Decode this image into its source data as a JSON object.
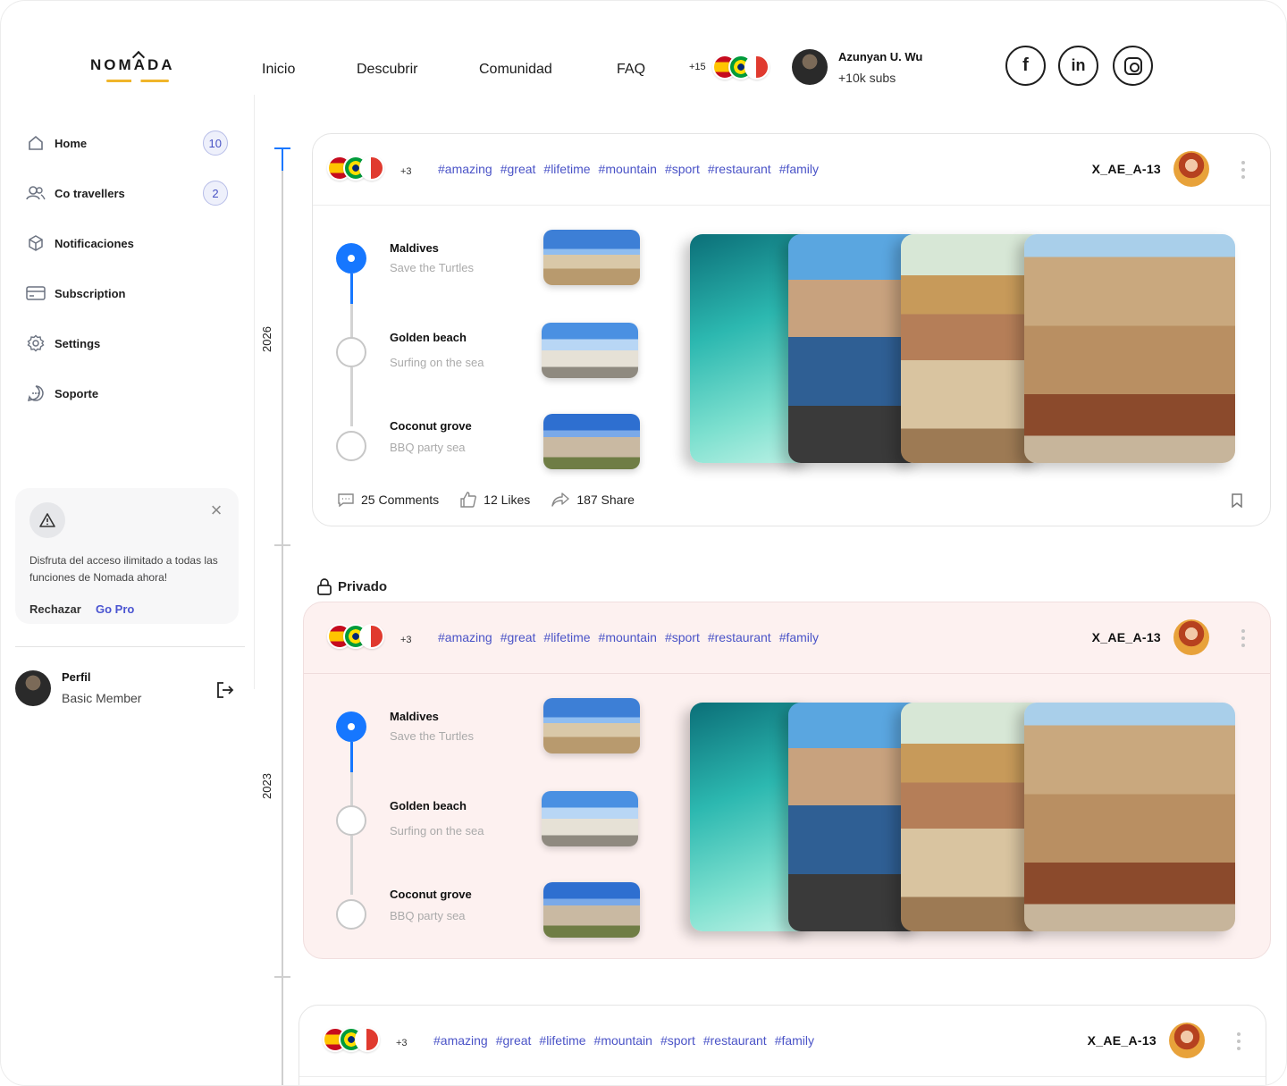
{
  "brand": {
    "logo_text": "NOMADA"
  },
  "nav": {
    "links": [
      "Inicio",
      "Descubrir",
      "Comunidad",
      "FAQ"
    ],
    "flag_extra": "+15",
    "user": {
      "name": "Azunyan U. Wu",
      "subs": "+10k subs"
    },
    "social": [
      "facebook-icon",
      "linkedin-icon",
      "instagram-icon"
    ]
  },
  "sidebar": {
    "items": [
      {
        "label": "Home",
        "icon": "home-icon",
        "badge": "10"
      },
      {
        "label": "Co travellers",
        "icon": "users-icon",
        "badge": "2"
      },
      {
        "label": "Notificaciones",
        "icon": "cube-icon",
        "badge": ""
      },
      {
        "label": "Subscription",
        "icon": "card-icon",
        "badge": ""
      },
      {
        "label": "Settings",
        "icon": "gear-icon",
        "badge": ""
      },
      {
        "label": "Soporte",
        "icon": "chat-icon",
        "badge": ""
      }
    ],
    "promo": {
      "text": "Disfruta del acceso ilimitado a todas las funciones de Nomada ahora!",
      "reject": "Rechazar",
      "gopro": "Go Pro"
    },
    "profile": {
      "name": "Perfil",
      "role": "Basic Member"
    }
  },
  "timeline": {
    "years": [
      "2026",
      "2023"
    ]
  },
  "private_label": "Privado",
  "cards": [
    {
      "flags_extra": "+3",
      "tags": [
        "#amazing",
        "#great",
        "#lifetime",
        "#mountain",
        "#sport",
        "#restaurant",
        "#family"
      ],
      "user": "X_AE_A-13",
      "stops": [
        {
          "title": "Maldives",
          "subtitle": "Save the Turtles"
        },
        {
          "title": "Golden beach",
          "subtitle": "Surfing on the sea"
        },
        {
          "title": "Coconut grove",
          "subtitle": "BBQ party  sea"
        }
      ],
      "footer": {
        "comments": "25 Comments",
        "likes": "12 Likes",
        "share": "187 Share"
      }
    },
    {
      "flags_extra": "+3",
      "tags": [
        "#amazing",
        "#great",
        "#lifetime",
        "#mountain",
        "#sport",
        "#restaurant",
        "#family"
      ],
      "user": "X_AE_A-13",
      "stops": [
        {
          "title": "Maldives",
          "subtitle": "Save the Turtles"
        },
        {
          "title": "Golden beach",
          "subtitle": "Surfing on the sea"
        },
        {
          "title": "Coconut grove",
          "subtitle": "BBQ party  sea"
        }
      ]
    },
    {
      "flags_extra": "+3",
      "tags": [
        "#amazing",
        "#great",
        "#lifetime",
        "#mountain",
        "#sport",
        "#restaurant",
        "#family"
      ],
      "user": "X_AE_A-13"
    }
  ],
  "colors": {
    "accent": "#1677ff",
    "tag": "#4a53c7",
    "private_bg": "#fdf1f0"
  }
}
